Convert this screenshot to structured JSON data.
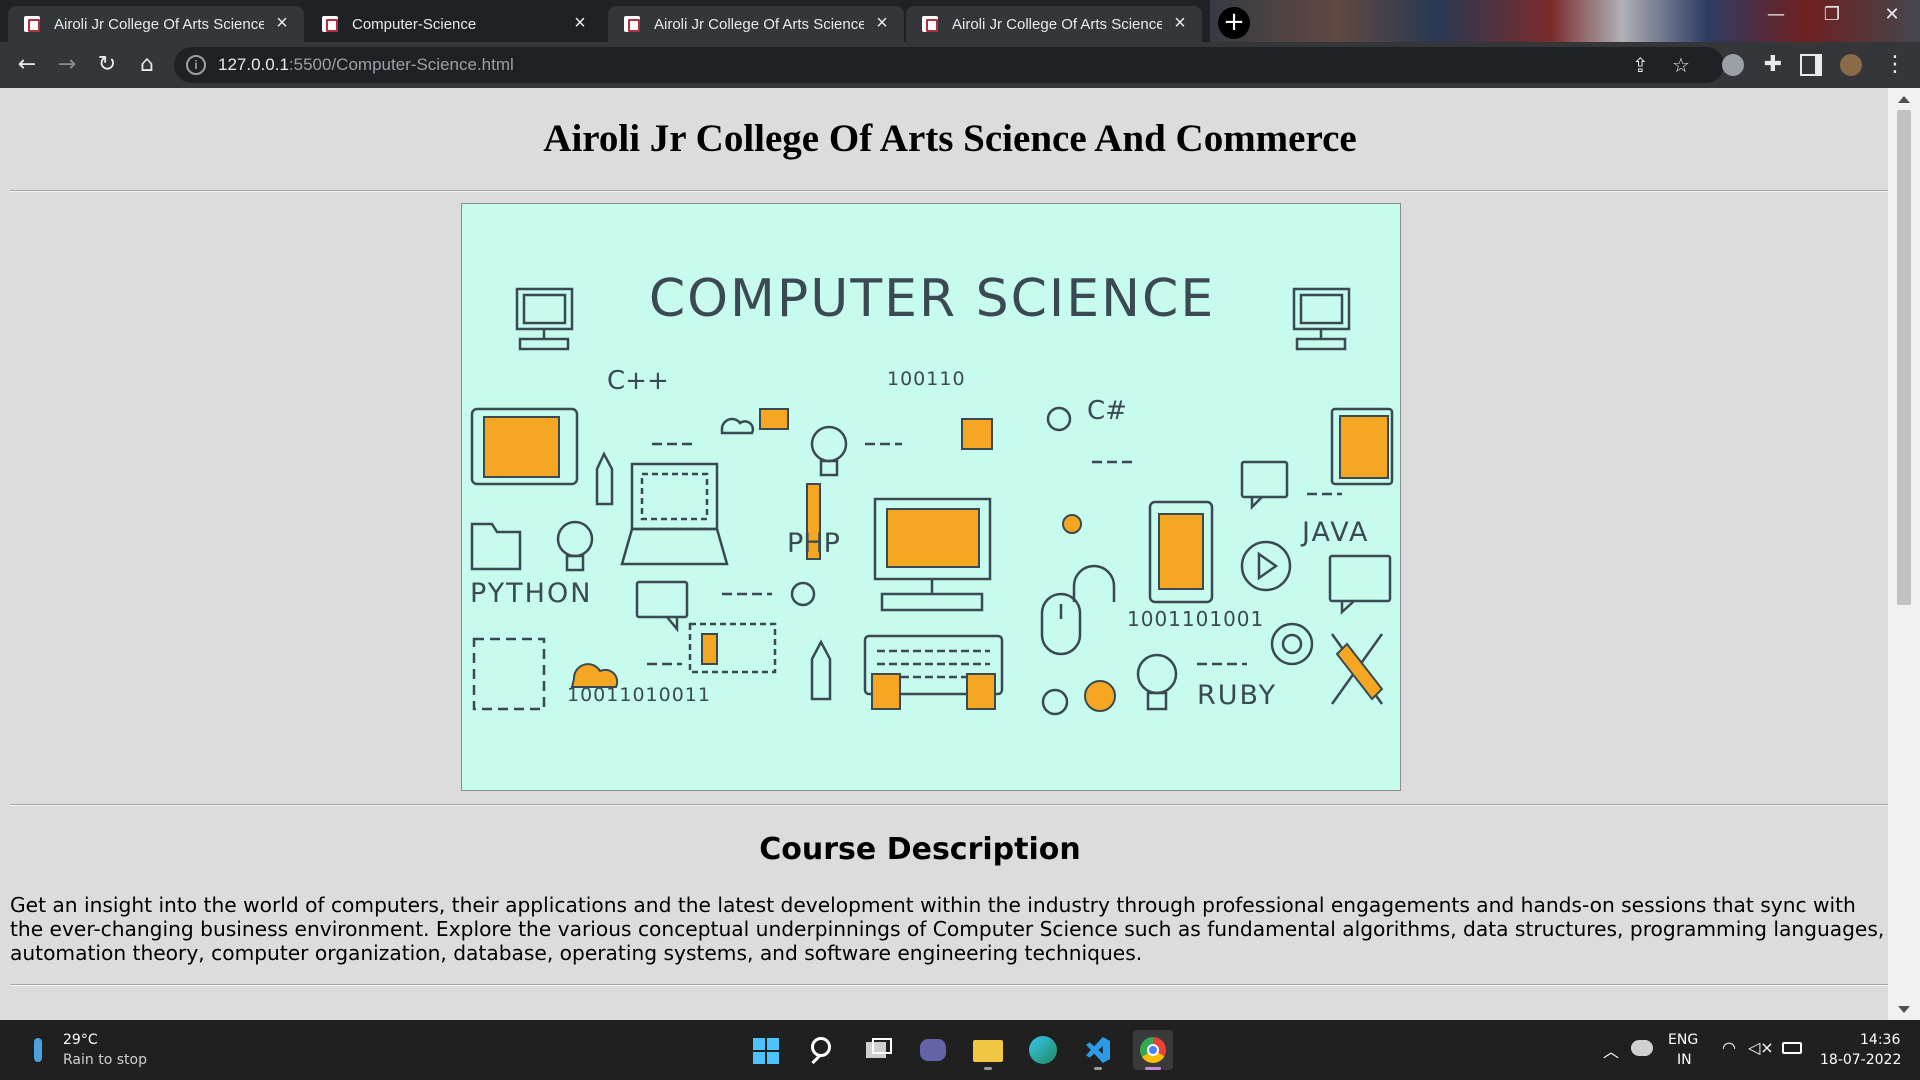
{
  "browser": {
    "tabs": [
      {
        "title": "Airoli Jr College Of Arts Science A",
        "active": true
      },
      {
        "title": "Computer-Science",
        "active": false
      },
      {
        "title": "Airoli Jr College Of Arts Science A",
        "active": true
      },
      {
        "title": "Airoli Jr College Of Arts Science A",
        "active": true
      }
    ],
    "url_host": "127.0.0.1",
    "url_path": ":5500/Computer-Science.html"
  },
  "page": {
    "site_title": "Airoli Jr College Of Arts Science And Commerce",
    "banner": {
      "heading": "COMPUTER SCIENCE",
      "labels": [
        "C++",
        "100110",
        "C#",
        "PHP",
        "JAVA",
        "PYTHON",
        "1001101001",
        "10011010011",
        "RUBY"
      ],
      "colors": {
        "background": "#c6fbee",
        "accent": "#f5a623",
        "line": "#3b4a52"
      }
    },
    "section_title": "Course Description",
    "description": "Get an insight into the world of computers, their applications and the latest development within the industry through professional engagements and hands-on sessions that sync with the ever-changing business environment. Explore the various conceptual underpinnings of Computer Science such as fundamental algorithms, data structures, programming languages, automation theory, computer organization, database, operating systems, and software engineering techniques."
  },
  "taskbar": {
    "weather_temp": "29°C",
    "weather_text": "Rain to stop",
    "lang": "ENG",
    "region": "IN",
    "time": "14:36",
    "date": "18-07-2022",
    "icons": [
      "start-icon",
      "search-icon",
      "task-view-icon",
      "chat-icon",
      "file-explorer-icon",
      "edge-icon",
      "vscode-icon",
      "chrome-icon"
    ]
  }
}
